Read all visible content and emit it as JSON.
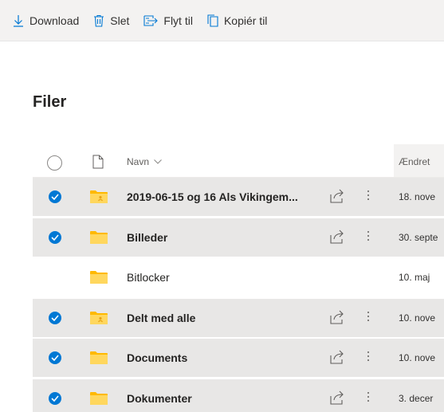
{
  "commands": {
    "download": "Download",
    "delete": "Slet",
    "move": "Flyt til",
    "copy": "Kopiér til"
  },
  "page_title": "Filer",
  "columns": {
    "name": "Navn",
    "modified": "Ændret"
  },
  "files": [
    {
      "name": "2019-06-15 og 16 Als Vikingem...",
      "modified": "18. nove",
      "selected": true,
      "shared": true
    },
    {
      "name": "Billeder",
      "modified": "30. septe",
      "selected": true,
      "shared": false
    },
    {
      "name": "Bitlocker",
      "modified": "10. maj",
      "selected": false,
      "shared": false
    },
    {
      "name": "Delt med alle",
      "modified": "10. nove",
      "selected": true,
      "shared": true
    },
    {
      "name": "Documents",
      "modified": "10. nove",
      "selected": true,
      "shared": false
    },
    {
      "name": "Dokumenter",
      "modified": "3. decer",
      "selected": true,
      "shared": false
    }
  ],
  "colors": {
    "accent": "#0078d4",
    "folder": "#ffb900",
    "selected_row": "#e8e7e6"
  }
}
